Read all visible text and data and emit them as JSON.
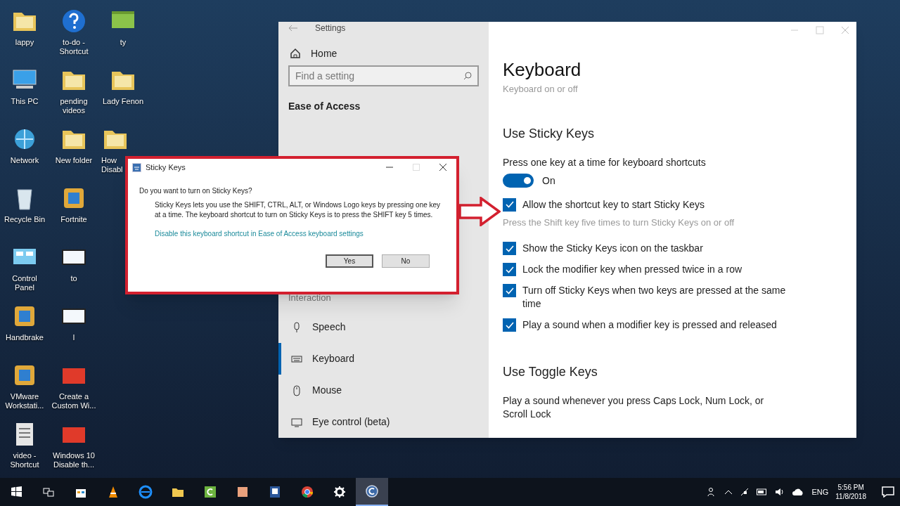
{
  "desktop": {
    "columns": [
      [
        {
          "label": "lappy",
          "kind": "folder"
        },
        {
          "label": "This PC",
          "kind": "pc"
        },
        {
          "label": "Network",
          "kind": "network"
        },
        {
          "label": "Recycle Bin",
          "kind": "recycle"
        },
        {
          "label": "Control Panel",
          "kind": "panel"
        },
        {
          "label": "Handbrake",
          "kind": "app"
        },
        {
          "label": "VMware Workstati...",
          "kind": "app"
        },
        {
          "label": "video - Shortcut",
          "kind": "doc"
        }
      ],
      [
        {
          "label": "to-do - Shortcut",
          "kind": "help"
        },
        {
          "label": "pending videos",
          "kind": "folder"
        },
        {
          "label": "New folder",
          "kind": "folder"
        },
        {
          "label": "Fortnite",
          "kind": "app"
        },
        {
          "label": "to",
          "kind": "file"
        },
        {
          "label": "l",
          "kind": "file"
        },
        {
          "label": "Create a Custom Wi...",
          "kind": "media"
        },
        {
          "label": "Windows 10 Disable th...",
          "kind": "media"
        }
      ],
      [
        {
          "label": "ty",
          "kind": "image"
        },
        {
          "label": "Lady Fenon",
          "kind": "folder"
        },
        {
          "label": "How Disabl",
          "kind": "folder"
        }
      ]
    ]
  },
  "settings": {
    "title": "Settings",
    "sidebar": {
      "home": "Home",
      "search": {
        "placeholder": "Find a setting"
      },
      "category": "Ease of Access",
      "group": "Interaction",
      "items": [
        {
          "label": "Speech",
          "kind": "mic",
          "selected": false
        },
        {
          "label": "Keyboard",
          "kind": "keyboard",
          "selected": true
        },
        {
          "label": "Mouse",
          "kind": "mouse",
          "selected": false
        },
        {
          "label": "Eye control (beta)",
          "kind": "eye",
          "selected": false
        }
      ]
    },
    "page": {
      "title": "Keyboard",
      "subtitle": "Keyboard on or off",
      "sections": [
        {
          "heading": "Use Sticky Keys",
          "description": "Press one key at a time for keyboard shortcuts",
          "toggle": {
            "on": true,
            "label": "On"
          },
          "options": [
            {
              "label": "Allow the shortcut key to start Sticky Keys",
              "checked": true,
              "hint": "Press the Shift key five times to turn Sticky Keys on or off"
            },
            {
              "label": "Show the Sticky Keys icon on the taskbar",
              "checked": true
            },
            {
              "label": "Lock the modifier key when pressed twice in a row",
              "checked": true
            },
            {
              "label": "Turn off Sticky Keys when two keys are pressed at the same time",
              "checked": true
            },
            {
              "label": "Play a sound when a modifier key is pressed and released",
              "checked": true
            }
          ]
        },
        {
          "heading": "Use Toggle Keys",
          "description": "Play a sound whenever you press Caps Lock, Num Lock, or Scroll Lock"
        }
      ]
    }
  },
  "dialog": {
    "title": "Sticky Keys",
    "question": "Do you want to turn on Sticky Keys?",
    "body": "Sticky Keys lets you use the SHIFT, CTRL, ALT, or Windows Logo keys by pressing one key at a time. The keyboard shortcut to turn on Sticky Keys is to press the SHIFT key 5 times.",
    "link": "Disable this keyboard shortcut in Ease of Access keyboard settings",
    "buttons": [
      {
        "label": "Yes",
        "selected": true
      },
      {
        "label": "No",
        "selected": false
      }
    ]
  },
  "taskbar": {
    "apps": [
      {
        "kind": "start",
        "selected": false
      },
      {
        "kind": "taskview",
        "selected": false
      },
      {
        "kind": "store",
        "selected": false
      },
      {
        "kind": "cone",
        "selected": false
      },
      {
        "kind": "edge",
        "selected": false
      },
      {
        "kind": "explorer",
        "selected": false
      },
      {
        "kind": "green",
        "selected": false
      },
      {
        "kind": "orange",
        "selected": false
      },
      {
        "kind": "word",
        "selected": false
      },
      {
        "kind": "chrome",
        "selected": false
      },
      {
        "kind": "gear",
        "selected": false
      },
      {
        "kind": "circle",
        "selected": true
      }
    ],
    "language": "ENG",
    "time": "5:56 PM",
    "date": "11/8/2018"
  }
}
